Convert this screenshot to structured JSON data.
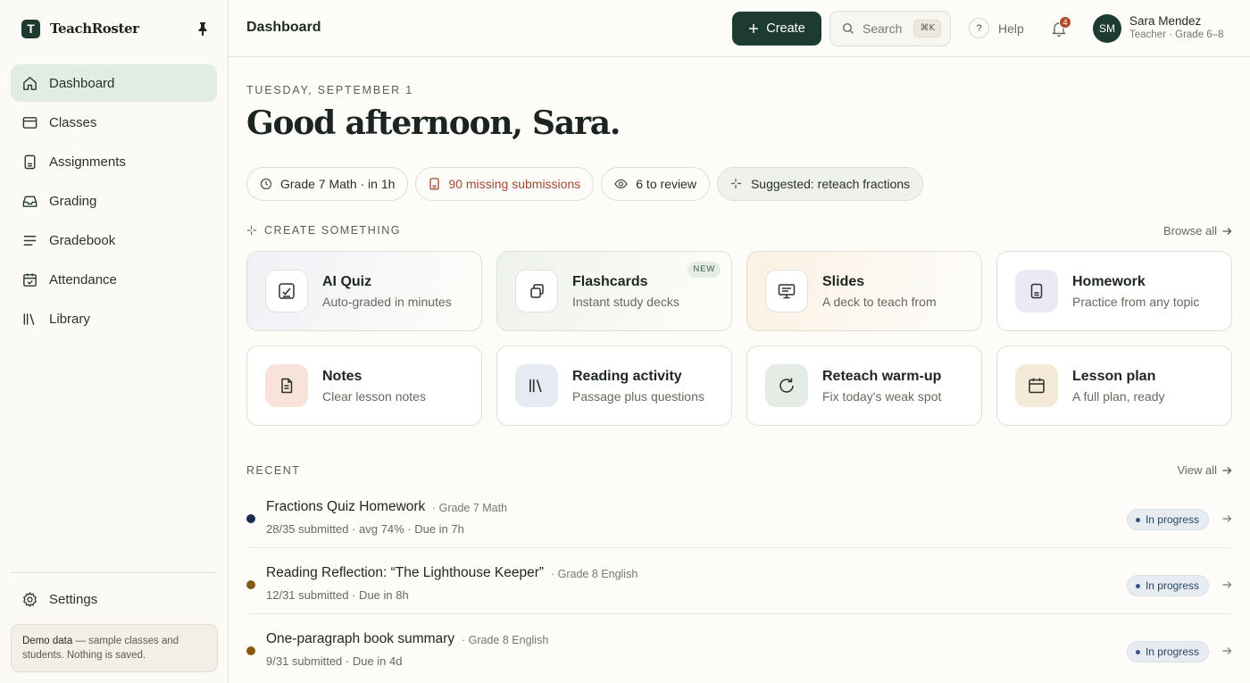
{
  "app": {
    "name": "TeachRoster",
    "logo_letter": "T"
  },
  "sidebar": {
    "items": [
      {
        "label": "Dashboard",
        "icon": "home-icon"
      },
      {
        "label": "Classes",
        "icon": "window-icon"
      },
      {
        "label": "Assignments",
        "icon": "document-icon"
      },
      {
        "label": "Grading",
        "icon": "inbox-icon"
      },
      {
        "label": "Gradebook",
        "icon": "lines-icon"
      },
      {
        "label": "Attendance",
        "icon": "calendar-check-icon"
      },
      {
        "label": "Library",
        "icon": "books-icon"
      }
    ],
    "settings_label": "Settings",
    "demo_title": "Demo data",
    "demo_text": " — sample classes and students. Nothing is saved."
  },
  "topbar": {
    "title": "Dashboard",
    "create_label": "Create",
    "search_placeholder": "Search",
    "search_shortcut": "⌘K",
    "help_label": "Help",
    "help_symbol": "?",
    "notification_count": "4",
    "user": {
      "initials": "SM",
      "name": "Sara Mendez",
      "role": "Teacher · Grade 6–8"
    }
  },
  "main": {
    "date": "TUESDAY, SEPTEMBER 1",
    "greeting": "Good afternoon, Sara.",
    "chips": [
      {
        "label": "Grade 7 Math · in 1h",
        "icon": "clock-icon"
      },
      {
        "label": "90 missing submissions",
        "icon": "document-icon"
      },
      {
        "label": "6 to review",
        "icon": "eye-icon"
      },
      {
        "label": "Suggested: reteach fractions",
        "icon": "sparkle-icon"
      }
    ],
    "create_section": {
      "label": "CREATE SOMETHING",
      "link": "Browse all"
    },
    "cards": [
      {
        "title": "AI Quiz",
        "subtitle": "Auto-graded in minutes"
      },
      {
        "title": "Flashcards",
        "subtitle": "Instant study decks",
        "badge": "NEW"
      },
      {
        "title": "Slides",
        "subtitle": "A deck to teach from"
      },
      {
        "title": "Homework",
        "subtitle": "Practice from any topic"
      },
      {
        "title": "Notes",
        "subtitle": "Clear lesson notes"
      },
      {
        "title": "Reading activity",
        "subtitle": "Passage plus questions"
      },
      {
        "title": "Reteach warm-up",
        "subtitle": "Fix today's weak spot"
      },
      {
        "title": "Lesson plan",
        "subtitle": "A full plan, ready"
      }
    ],
    "recent_section": {
      "label": "RECENT",
      "link": "View all"
    },
    "recent": [
      {
        "title": "Fractions Quiz Homework",
        "class": "· Grade 7 Math",
        "meta": "28/35 submitted · avg 74% · Due in 7h",
        "status": "In progress",
        "dot_color": "#1b2c4e"
      },
      {
        "title": "Reading Reflection: “The Lighthouse Keeper”",
        "class": "· Grade 8 English",
        "meta": "12/31 submitted · Due in 8h",
        "status": "In progress",
        "dot_color": "#8a5a12"
      },
      {
        "title": "One-paragraph book summary",
        "class": "· Grade 8 English",
        "meta": "9/31 submitted · Due in 4d",
        "status": "In progress",
        "dot_color": "#8a5a12"
      }
    ]
  }
}
